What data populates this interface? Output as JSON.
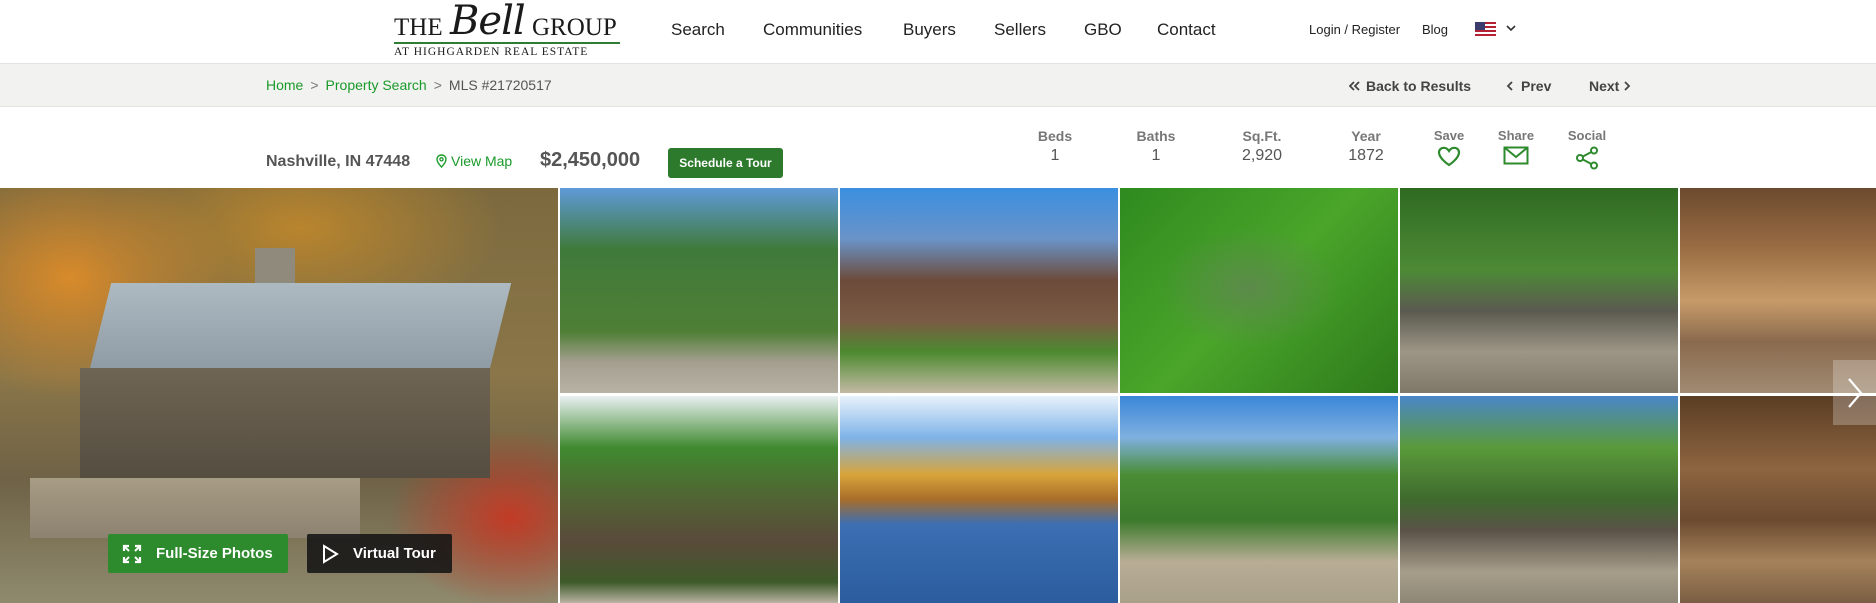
{
  "brand": {
    "the": "THE",
    "bell": "Bell",
    "group": "GROUP",
    "subtitle": "AT HIGHGARDEN REAL ESTATE"
  },
  "nav": {
    "items": [
      "Search",
      "Communities",
      "Buyers",
      "Sellers",
      "GBO",
      "Contact"
    ],
    "login": "Login / Register",
    "blog": "Blog",
    "language_icon": "us-flag-icon"
  },
  "breadcrumb": {
    "home": "Home",
    "property_search": "Property Search",
    "separator": ">",
    "current": "MLS #21720517"
  },
  "crumb_nav": {
    "back": "Back to Results",
    "prev": "Prev",
    "next": "Next"
  },
  "listing": {
    "address": "Nashville, IN 47448",
    "view_map": "View Map",
    "price": "$2,450,000",
    "schedule_tour": "Schedule a Tour",
    "stats": [
      {
        "label": "Beds",
        "value": "1"
      },
      {
        "label": "Baths",
        "value": "1"
      },
      {
        "label": "Sq.Ft.",
        "value": "2,920"
      },
      {
        "label": "Year",
        "value": "1872"
      }
    ],
    "actions": [
      {
        "label": "Save",
        "icon": "heart-icon"
      },
      {
        "label": "Share",
        "icon": "envelope-icon"
      },
      {
        "label": "Social",
        "icon": "share-nodes-icon"
      }
    ],
    "accent_color": "#2d7a2d",
    "link_color": "#1a9a2a"
  },
  "gallery": {
    "full_size": "Full-Size Photos",
    "virtual_tour": "Virtual Tour"
  }
}
